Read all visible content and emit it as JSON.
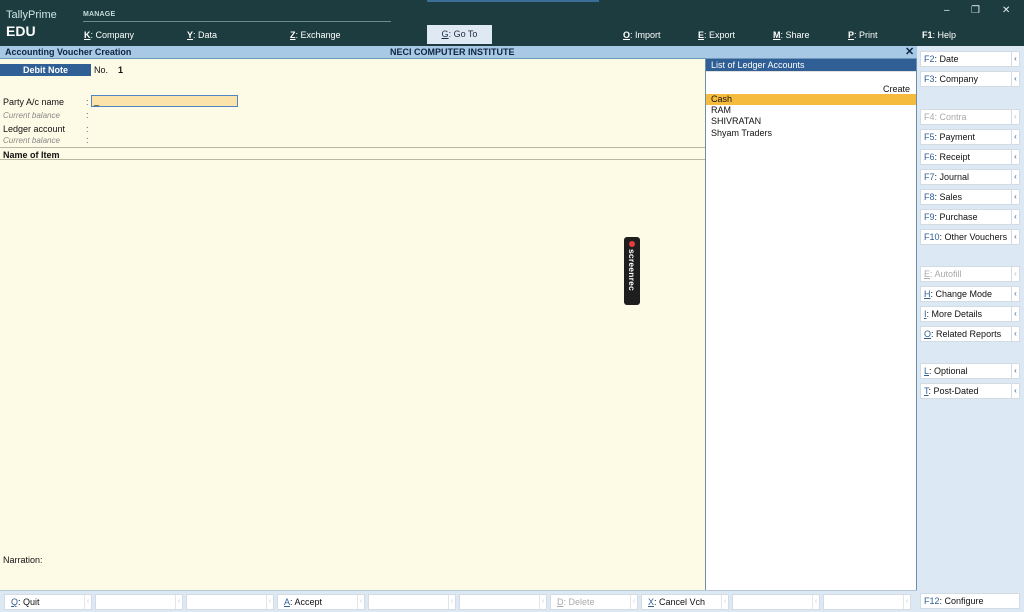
{
  "app": {
    "name": "TallyPrime",
    "edition": "EDU"
  },
  "topmenu": {
    "section": "MANAGE",
    "items": [
      {
        "key": "K",
        "label": "Company"
      },
      {
        "key": "Y",
        "label": "Data"
      },
      {
        "key": "Z",
        "label": "Exchange"
      }
    ],
    "goto": {
      "key": "G",
      "label": "Go To"
    },
    "right": [
      {
        "key": "O",
        "label": "Import"
      },
      {
        "key": "E",
        "label": "Export"
      },
      {
        "key": "M",
        "label": "Share"
      },
      {
        "key": "P",
        "label": "Print"
      },
      {
        "key": "F1",
        "label": "Help"
      }
    ]
  },
  "window": {
    "minimize": "–",
    "restore": "❐",
    "close": "✕"
  },
  "titlebar": {
    "title": "Accounting Voucher Creation",
    "company": "NECI COMPUTER INSTITUTE",
    "close": "✕"
  },
  "voucher": {
    "type": "Debit Note",
    "no_label": "No.",
    "no_value": "1",
    "party_label": "Party A/c name",
    "current_balance_label": "Current balance",
    "ledger_label": "Ledger account",
    "colon": ":",
    "party_value": "_",
    "name_of_item": "Name of Item",
    "narration_label": "Narration:"
  },
  "ledger_list": {
    "title": "List of Ledger Accounts",
    "create": "Create",
    "items": [
      "Cash",
      "RAM",
      "SHIVRATAN",
      "Shyam Traders"
    ],
    "selected_index": 0
  },
  "right_buttons": [
    {
      "key": "F2",
      "label": "Date",
      "enabled": true,
      "chevron": true
    },
    {
      "key": "F3",
      "label": "Company",
      "enabled": true,
      "chevron": true
    },
    {
      "key": "F4",
      "label": "Contra",
      "enabled": false,
      "chevron": true
    },
    {
      "key": "F5",
      "label": "Payment",
      "enabled": true,
      "chevron": true
    },
    {
      "key": "F6",
      "label": "Receipt",
      "enabled": true,
      "chevron": true
    },
    {
      "key": "F7",
      "label": "Journal",
      "enabled": true,
      "chevron": true
    },
    {
      "key": "F8",
      "label": "Sales",
      "enabled": true,
      "chevron": true
    },
    {
      "key": "F9",
      "label": "Purchase",
      "enabled": true,
      "chevron": true
    },
    {
      "key": "F10",
      "label": "Other Vouchers",
      "enabled": true,
      "chevron": true
    },
    {
      "key": "E",
      "label": "Autofill",
      "enabled": false,
      "chevron": true
    },
    {
      "key": "H",
      "label": "Change Mode",
      "enabled": true,
      "chevron": true
    },
    {
      "key": "I",
      "label": "More Details",
      "enabled": true,
      "chevron": true
    },
    {
      "key": "O",
      "label": "Related Reports",
      "enabled": true,
      "chevron": true
    },
    {
      "key": "L",
      "label": "Optional",
      "enabled": true,
      "chevron": true
    },
    {
      "key": "T",
      "label": "Post-Dated",
      "enabled": true,
      "chevron": true
    }
  ],
  "bottom_buttons": [
    {
      "key": "Q",
      "label": "Quit",
      "enabled": true
    },
    {
      "key": "",
      "label": "",
      "enabled": true
    },
    {
      "key": "",
      "label": "",
      "enabled": true
    },
    {
      "key": "A",
      "label": "Accept",
      "enabled": true
    },
    {
      "key": "",
      "label": "",
      "enabled": true
    },
    {
      "key": "",
      "label": "",
      "enabled": true
    },
    {
      "key": "D",
      "label": "Delete",
      "enabled": false
    },
    {
      "key": "X",
      "label": "Cancel Vch",
      "enabled": true
    },
    {
      "key": "",
      "label": "",
      "enabled": true
    },
    {
      "key": "",
      "label": "",
      "enabled": true
    }
  ],
  "f12": {
    "key": "F12",
    "label": "Configure"
  },
  "overlay": {
    "text": "screenrec"
  },
  "colors": {
    "topbar": "#1d3c3f",
    "titlebar": "#a8c9e6",
    "accent": "#2f5f95",
    "selection": "#f5bb3c",
    "background": "#fdfbe6",
    "panel": "#dce9f4"
  }
}
